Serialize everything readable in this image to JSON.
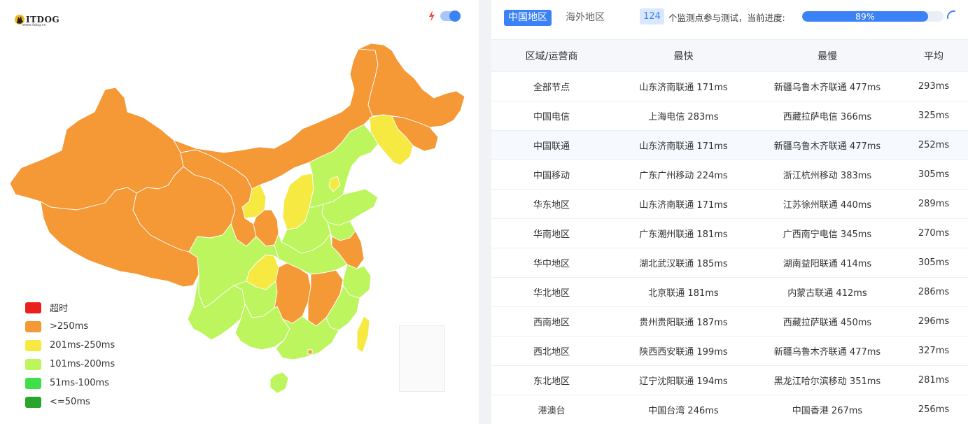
{
  "logo": {
    "text": "ITDOG",
    "sub": "www.itdog.cn"
  },
  "speed_toggle": {
    "icon": "lightning-icon",
    "on": true
  },
  "colors": {
    "timeout": "#e8211e",
    "gt250": "#f59836",
    "r201_250": "#f5e942",
    "r101_200": "#bdf55e",
    "r51_100": "#40df4a",
    "le50": "#28a52a"
  },
  "legend": [
    {
      "label": "超时",
      "color": "#e8211e"
    },
    {
      "label": ">250ms",
      "color": "#f59836"
    },
    {
      "label": "201ms-250ms",
      "color": "#f5e942"
    },
    {
      "label": "101ms-200ms",
      "color": "#bdf55e"
    },
    {
      "label": "51ms-100ms",
      "color": "#40df4a"
    },
    {
      "label": "<=50ms",
      "color": "#28a52a"
    }
  ],
  "tabs": {
    "china": "中国地区",
    "overseas": "海外地区"
  },
  "monitor": {
    "count": "124",
    "text": "个监测点参与测试，当前进度:",
    "progress_value": 0.89,
    "progress_label": "89%"
  },
  "table": {
    "headers": [
      "区域/运营商",
      "最快",
      "最慢",
      "平均"
    ],
    "rows": [
      [
        "全部节点",
        "山东济南联通 171ms",
        "新疆乌鲁木齐联通 477ms",
        "293ms"
      ],
      [
        "中国电信",
        "上海电信 283ms",
        "西藏拉萨电信 366ms",
        "325ms"
      ],
      [
        "中国联通",
        "山东济南联通 171ms",
        "新疆乌鲁木齐联通 477ms",
        "252ms"
      ],
      [
        "中国移动",
        "广东广州移动 224ms",
        "浙江杭州移动 383ms",
        "305ms"
      ],
      [
        "华东地区",
        "山东济南联通 171ms",
        "江苏徐州联通 440ms",
        "289ms"
      ],
      [
        "华南地区",
        "广东潮州联通 181ms",
        "广西南宁电信 345ms",
        "270ms"
      ],
      [
        "华中地区",
        "湖北武汉联通 185ms",
        "湖南益阳联通 414ms",
        "305ms"
      ],
      [
        "华北地区",
        "北京联通 181ms",
        "内蒙古联通 412ms",
        "286ms"
      ],
      [
        "西南地区",
        "贵州贵阳联通 187ms",
        "西藏拉萨联通 450ms",
        "296ms"
      ],
      [
        "西北地区",
        "陕西西安联通 199ms",
        "新疆乌鲁木齐联通 477ms",
        "327ms"
      ],
      [
        "东北地区",
        "辽宁沈阳联通 194ms",
        "黑龙江哈尔滨移动 351ms",
        "281ms"
      ],
      [
        "港澳台",
        "中国台湾 246ms",
        "中国香港 267ms",
        "256ms"
      ]
    ],
    "highlight_row": 2
  }
}
